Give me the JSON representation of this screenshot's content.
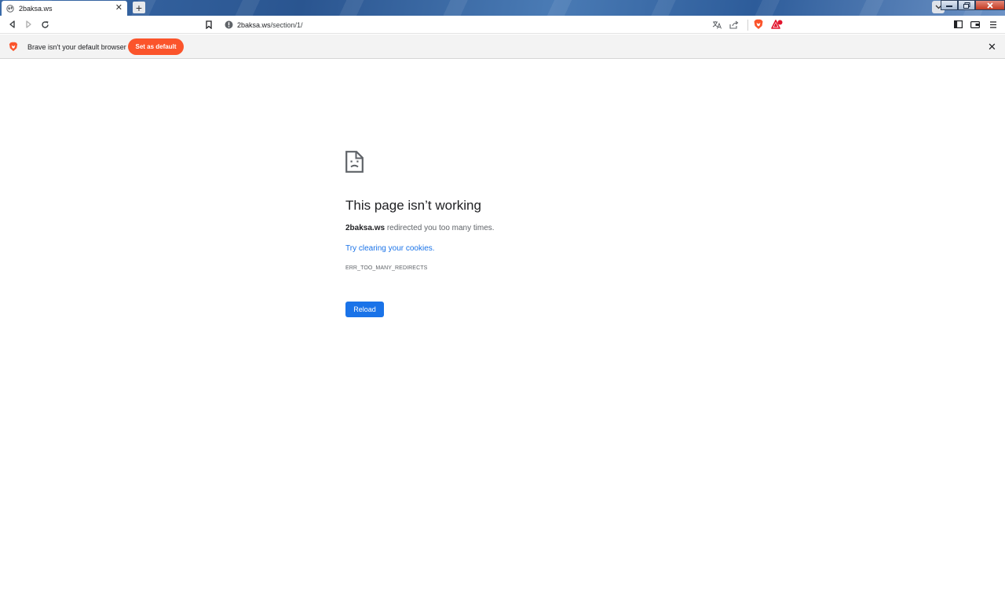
{
  "window": {
    "tab_title": "2baksa.ws",
    "tab_close": "✕",
    "new_tab": "+"
  },
  "toolbar": {
    "url_host": "2baksa.ws",
    "url_path": "/section/1/"
  },
  "infobar": {
    "message": "Brave isn't your default browser",
    "button_label": "Set as default",
    "close": "✕"
  },
  "error": {
    "title": "This page isn’t working",
    "host": "2baksa.ws",
    "description_rest": " redirected you too many times.",
    "link_text": "Try clearing your cookies.",
    "code": "ERR_TOO_MANY_REDIRECTS",
    "reload_label": "Reload"
  },
  "colors": {
    "brave_orange": "#fb542b",
    "link_blue": "#1a73e8",
    "reload_blue": "#1a73e8"
  },
  "icons": {
    "tab_favicon": "globe-icon",
    "back": "back-arrow-icon",
    "forward": "forward-arrow-icon",
    "reload": "reload-icon",
    "bookmark": "bookmark-icon",
    "site_info": "info-icon",
    "translate": "translate-icon",
    "share": "share-icon",
    "brave_shields": "brave-lion-icon",
    "rewards": "brave-rewards-icon",
    "sidebar": "sidebar-icon",
    "wallet": "wallet-icon",
    "menu": "hamburger-menu-icon",
    "error": "sad-document-icon"
  }
}
